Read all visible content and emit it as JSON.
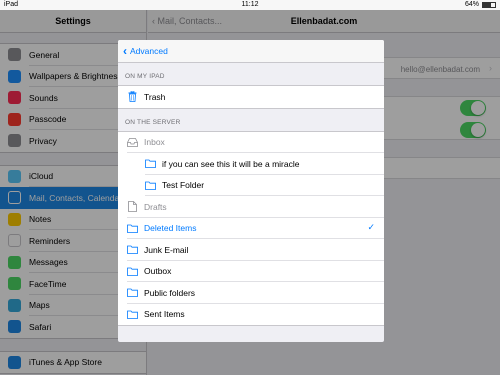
{
  "status_bar": {
    "device": "iPad",
    "time": "11:12",
    "battery": "64%",
    "battery_level": 0.64
  },
  "settings": {
    "title": "Settings",
    "group1": [
      {
        "label": "General",
        "icon": "gear-icon",
        "color": "#8e8e93"
      },
      {
        "label": "Wallpapers & Brightness",
        "icon": "wallpaper-icon",
        "color": "#1e90ff"
      },
      {
        "label": "Sounds",
        "icon": "sounds-icon",
        "color": "#ff2d55"
      },
      {
        "label": "Passcode",
        "icon": "passcode-icon",
        "color": "#ff3b30"
      },
      {
        "label": "Privacy",
        "icon": "privacy-icon",
        "color": "#8e8e93"
      }
    ],
    "group2": [
      {
        "label": "iCloud",
        "icon": "icloud-icon",
        "color": "#5ac8fa"
      },
      {
        "label": "Mail, Contacts, Calendars",
        "icon": "mail-icon",
        "color": "#1e88e5",
        "selected": true
      },
      {
        "label": "Notes",
        "icon": "notes-icon",
        "color": "#ffcc00"
      },
      {
        "label": "Reminders",
        "icon": "reminders-icon",
        "color": "#ffffff"
      },
      {
        "label": "Messages",
        "icon": "messages-icon",
        "color": "#4cd964"
      },
      {
        "label": "FaceTime",
        "icon": "facetime-icon",
        "color": "#4cd964"
      },
      {
        "label": "Maps",
        "icon": "maps-icon",
        "color": "#34aadc"
      },
      {
        "label": "Safari",
        "icon": "safari-icon",
        "color": "#1e88e5"
      }
    ],
    "group3": [
      {
        "label": "iTunes & App Store",
        "icon": "appstore-icon",
        "color": "#1e88e5"
      }
    ]
  },
  "detail": {
    "back_label": "Mail, Contacts...",
    "title": "Ellenbadat.com",
    "email": "hello@ellenbadat.com"
  },
  "modal": {
    "back_label": "Advanced",
    "section_ipad": "ON MY IPAD",
    "ipad_items": [
      {
        "label": "Trash",
        "icon": "trash-icon"
      }
    ],
    "section_server": "ON THE SERVER",
    "server_items": [
      {
        "label": "Inbox",
        "icon": "inbox-icon",
        "indent": 0,
        "gray": true
      },
      {
        "label": "if you can see this it will be a miracle",
        "icon": "folder-icon",
        "indent": 1
      },
      {
        "label": "Test Folder",
        "icon": "folder-icon",
        "indent": 1
      },
      {
        "label": "Drafts",
        "icon": "document-icon",
        "indent": 0,
        "gray": true
      },
      {
        "label": "Deleted Items",
        "icon": "folder-icon",
        "indent": 0,
        "selected": true
      },
      {
        "label": "Junk E-mail",
        "icon": "folder-icon",
        "indent": 0
      },
      {
        "label": "Outbox",
        "icon": "folder-icon",
        "indent": 0
      },
      {
        "label": "Public folders",
        "icon": "folder-icon",
        "indent": 0
      },
      {
        "label": "Sent Items",
        "icon": "folder-icon",
        "indent": 0
      }
    ],
    "checkmark": "✓",
    "accent": "#007aff"
  }
}
